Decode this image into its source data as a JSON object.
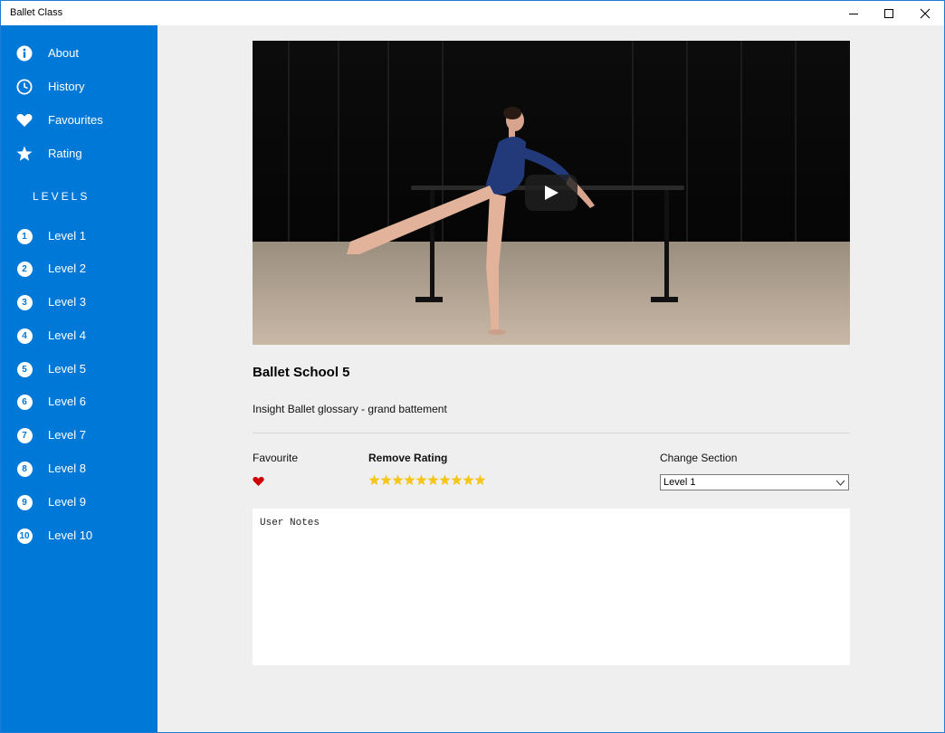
{
  "window": {
    "title": "Ballet Class",
    "controls": [
      "minimize-icon",
      "maximize-icon",
      "close-icon"
    ],
    "accent": "#0078d7"
  },
  "sidebar": {
    "menu": [
      {
        "label": "About",
        "icon": "info-icon"
      },
      {
        "label": "History",
        "icon": "clock-icon"
      },
      {
        "label": "Favourites",
        "icon": "heart-icon"
      },
      {
        "label": "Rating",
        "icon": "star-icon"
      }
    ],
    "levels_heading": "LEVELS",
    "levels": [
      {
        "number": "1",
        "label": "Level 1"
      },
      {
        "number": "2",
        "label": "Level 2"
      },
      {
        "number": "3",
        "label": "Level 3"
      },
      {
        "number": "4",
        "label": "Level 4"
      },
      {
        "number": "5",
        "label": "Level 5"
      },
      {
        "number": "6",
        "label": "Level 6"
      },
      {
        "number": "7",
        "label": "Level 7"
      },
      {
        "number": "8",
        "label": "Level 8"
      },
      {
        "number": "9",
        "label": "Level 9"
      },
      {
        "number": "10",
        "label": "Level 10"
      }
    ]
  },
  "main": {
    "video": {
      "icon": "play-icon"
    },
    "title": "Ballet School 5",
    "description": "Insight Ballet glossary - grand battement",
    "favourite": {
      "label": "Favourite",
      "is_favourite": true,
      "color": "#cc0000"
    },
    "rating": {
      "label": "Remove Rating",
      "stars": 10,
      "max": 10,
      "color": "#f5c518"
    },
    "section": {
      "label": "Change Section",
      "selected": "Level 1"
    },
    "notes": {
      "placeholder": "User Notes"
    }
  }
}
